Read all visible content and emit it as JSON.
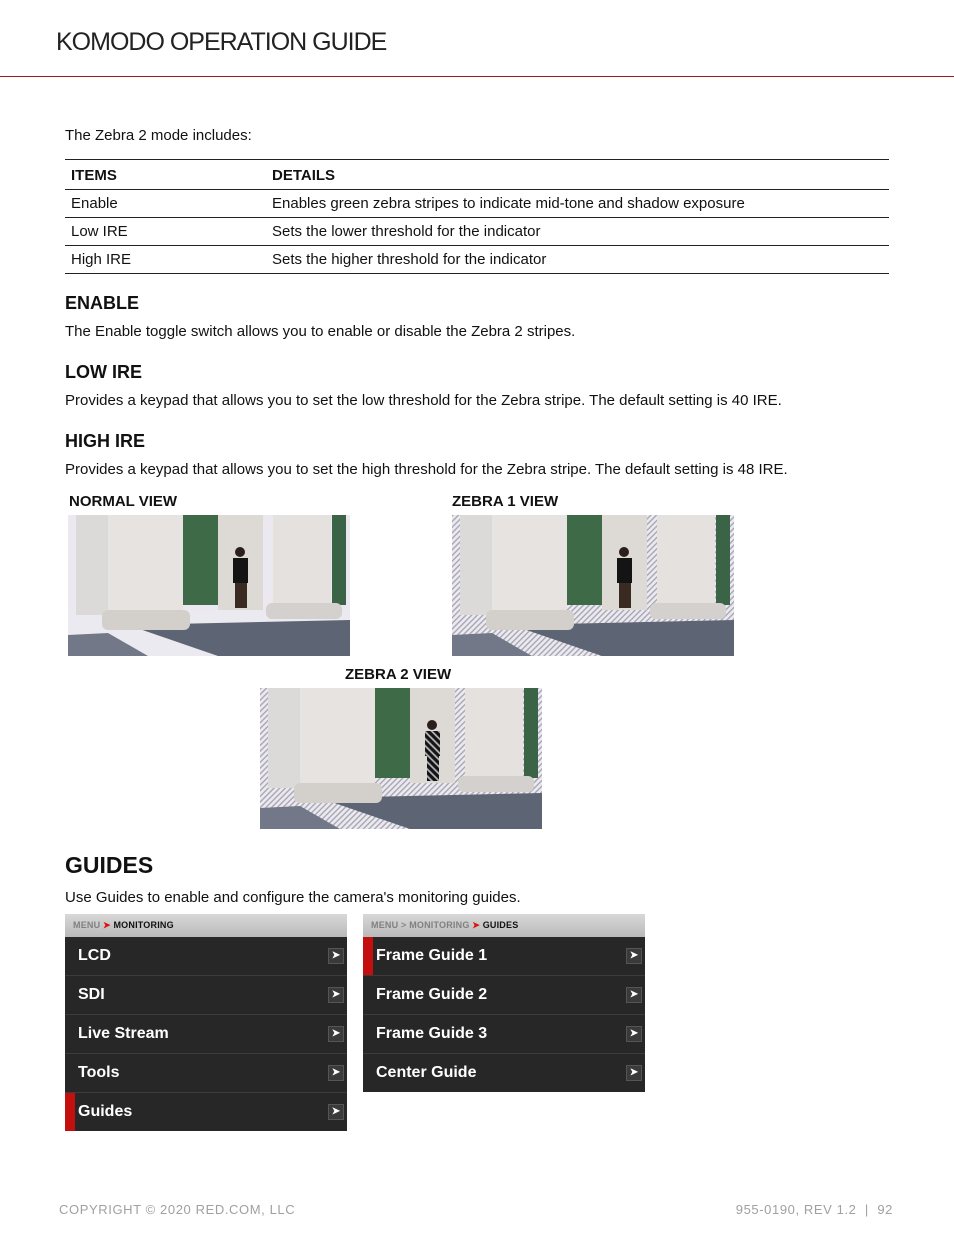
{
  "header": {
    "title": "KOMODO OPERATION GUIDE"
  },
  "intro": "The Zebra 2 mode includes:",
  "table": {
    "headers": [
      "ITEMS",
      "DETAILS"
    ],
    "rows": [
      [
        "Enable",
        "Enables green zebra stripes to indicate mid-tone and shadow exposure"
      ],
      [
        "Low IRE",
        "Sets the lower threshold for the indicator"
      ],
      [
        "High IRE",
        "Sets the higher threshold for the indicator"
      ]
    ]
  },
  "sections": [
    {
      "heading": "ENABLE",
      "body": "The Enable toggle switch allows you to enable or disable the Zebra 2 stripes."
    },
    {
      "heading": "LOW IRE",
      "body": "Provides a keypad that allows you to set the low threshold for the Zebra stripe. The default setting is 40 IRE."
    },
    {
      "heading": "HIGH IRE",
      "body": "Provides a keypad that allows you to set the high threshold for the Zebra stripe. The default setting is 48 IRE."
    }
  ],
  "images": {
    "normal": {
      "label": "NORMAL VIEW",
      "alt": "Marble columns with a person walking, normal exposure"
    },
    "zebra1": {
      "label": "ZEBRA 1 VIEW",
      "alt": "Same scene with zebra stripes over highlights"
    },
    "zebra2": {
      "label": "ZEBRA 2 VIEW",
      "alt": "Same scene with zebra stripes over mid-tones and shadows"
    }
  },
  "guides": {
    "heading": "GUIDES",
    "body": "Use Guides to enable and configure the camera's monitoring guides.",
    "menu_monitoring": {
      "breadcrumb": {
        "root": "MENU",
        "separator": "➤",
        "current": "MONITORING"
      },
      "items": [
        {
          "label": "LCD",
          "active": false
        },
        {
          "label": "SDI",
          "active": false
        },
        {
          "label": "Live Stream",
          "active": false
        },
        {
          "label": "Tools",
          "active": false
        },
        {
          "label": "Guides",
          "active": true
        }
      ]
    },
    "menu_guides": {
      "breadcrumb": {
        "root": "MENU",
        "mid_separator": ">",
        "mid": "MONITORING",
        "separator": "➤",
        "current": "GUIDES"
      },
      "items": [
        {
          "label": "Frame Guide 1",
          "active": true
        },
        {
          "label": "Frame Guide 2",
          "active": false
        },
        {
          "label": "Frame Guide 3",
          "active": false
        },
        {
          "label": "Center Guide",
          "active": false
        }
      ]
    }
  },
  "icons": {
    "submenu_arrow": "➤"
  },
  "colors": {
    "accent_red": "#c40f0f",
    "header_rule": "#9b1c1c",
    "menu_bg": "#272727"
  },
  "footer": {
    "copyright": "COPYRIGHT © 2020 RED.COM, LLC",
    "doc_ref": "955-0190, REV 1.2  |  92"
  }
}
